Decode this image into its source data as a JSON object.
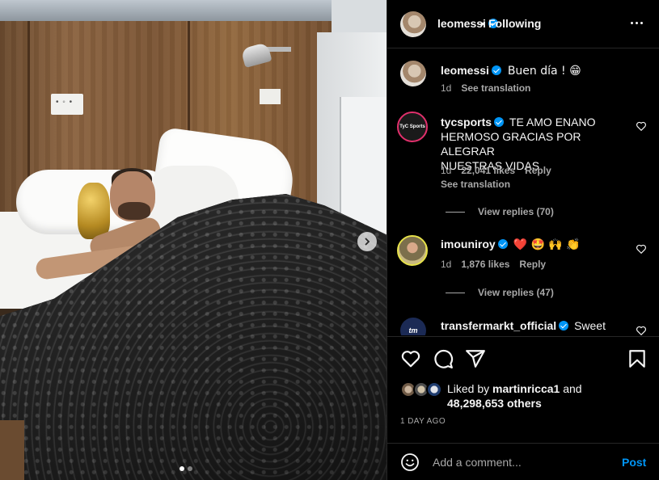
{
  "post": {
    "author": "leomessi",
    "follow_status": "Following",
    "separator": "•",
    "carousel": {
      "current": 1,
      "total": 2
    }
  },
  "caption": {
    "username": "leomessi",
    "text": "Buen día ! 😁",
    "time": "1d",
    "see_translation": "See translation"
  },
  "comments": [
    {
      "username": "tycsports",
      "avatar_text": "TyC Sports",
      "text_lines": [
        "TE AMO ENANO",
        "HERMOSO GRACIAS POR ALEGRAR",
        "NUESTRAS VIDAS"
      ],
      "time": "1d",
      "likes": "22,041 likes",
      "reply": "Reply",
      "see_translation": "See translation",
      "view_replies": "View replies (70)"
    },
    {
      "username": "imouniroy",
      "text": "❤️ 🤩 🙌 👏",
      "time": "1d",
      "likes": "1,876 likes",
      "reply": "Reply",
      "view_replies": "View replies (47)"
    },
    {
      "username": "transfermarkt_official",
      "avatar_text": "tm",
      "text": "Sweet"
    }
  ],
  "likes": {
    "prefix": "Liked by",
    "user": "martinricca1",
    "joiner": "and",
    "others": "48,298,653 others"
  },
  "date": "1 DAY AGO",
  "add_comment": {
    "placeholder": "Add a comment...",
    "post_label": "Post"
  },
  "colors": {
    "background": "#000000",
    "text": "#f5f5f5",
    "secondary": "#a8a8a8",
    "link_blue": "#0095f6",
    "divider": "#262626"
  },
  "icons": [
    "heart-icon",
    "comment-icon",
    "share-icon",
    "bookmark-icon",
    "emoji-icon",
    "more-icon",
    "verified-icon",
    "chevron-right-icon"
  ]
}
